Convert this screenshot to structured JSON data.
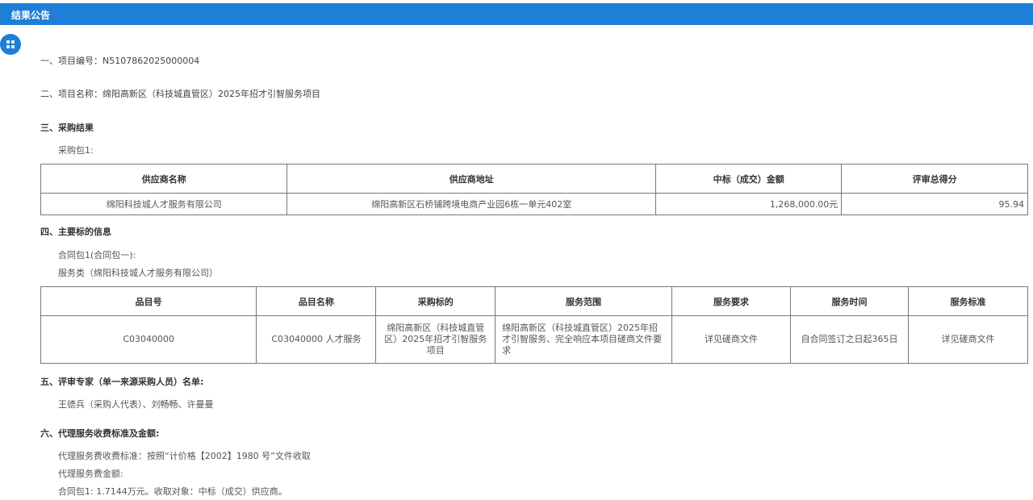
{
  "header": {
    "title": "结果公告"
  },
  "float_button": {
    "icon": "grid-icon"
  },
  "sections": {
    "project_no": "一、项目编号：N5107862025000004",
    "project_name": "二、项目名称：绵阳高新区（科技城直管区）2025年招才引智服务项目",
    "result_heading": "三、采购结果",
    "package_label": "采购包1:",
    "info_heading": "四、主要标的信息",
    "contract_label": "合同包1(合同包一):",
    "service_label": "服务类（绵阳科技城人才服务有限公司）",
    "experts_heading": "五、评审专家（单一来源采购人员）名单:",
    "experts": "王德兵（采购人代表）、刘畅畅、许曼曼",
    "fee_heading": "六、代理服务收费标准及金额:",
    "fee_standard": "代理服务费收费标准：按照“计价格【2002】1980  号”文件收取",
    "fee_amount_label": "代理服务费金额:",
    "fee_amount": "合同包1:  1.7144万元。收取对象：中标（成交）供应商。"
  },
  "results_table": {
    "headers": [
      "供应商名称",
      "供应商地址",
      "中标（成交）金额",
      "评审总得分"
    ],
    "rows": [
      [
        "绵阳科技城人才服务有限公司",
        "绵阳高新区石桥铺跨境电商产业园6栋一单元402室",
        "1,268,000.00元",
        "95.94"
      ]
    ]
  },
  "items_table": {
    "headers": [
      "品目号",
      "品目名称",
      "采购标的",
      "服务范围",
      "服务要求",
      "服务时间",
      "服务标准"
    ],
    "rows": [
      [
        "C03040000",
        "C03040000 人才服务",
        "绵阳高新区（科技城直管区）2025年招才引智服务项目",
        "绵阳高新区（科技城直管区）2025年招才引智服务、完全响应本项目磋商文件要求",
        "详见磋商文件",
        "自合同签订之日起365日",
        "详见磋商文件"
      ]
    ]
  },
  "colors": {
    "accent": "#1f7fd6"
  }
}
